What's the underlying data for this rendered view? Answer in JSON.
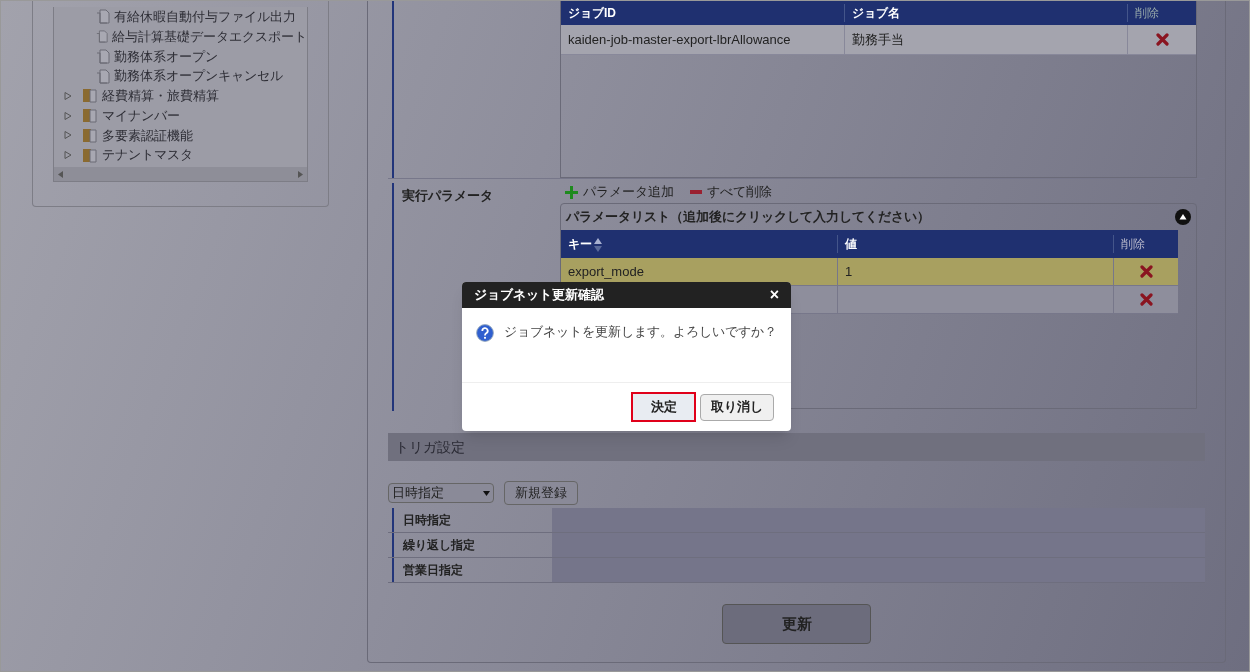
{
  "tree": {
    "items": [
      {
        "kind": "file",
        "label": "有給休暇自動付与ファイル出力"
      },
      {
        "kind": "file",
        "label": "給与計算基礎データエクスポート"
      },
      {
        "kind": "file",
        "label": "勤務体系オープン"
      },
      {
        "kind": "file",
        "label": "勤務体系オープンキャンセル"
      },
      {
        "kind": "folder",
        "label": "経費精算・旅費精算",
        "expanded": false
      },
      {
        "kind": "folder",
        "label": "マイナンバー",
        "expanded": false
      },
      {
        "kind": "folder",
        "label": "多要素認証機能",
        "expanded": false
      },
      {
        "kind": "folder",
        "label": "テナントマスタ",
        "expanded": false
      }
    ]
  },
  "jobs": {
    "columns": [
      "ジョブID",
      "ジョブ名",
      "削除"
    ],
    "rows": [
      {
        "id": "kaiden-job-master-export-lbrAllowance",
        "name": "勤務手当"
      }
    ]
  },
  "params": {
    "label": "実行パラメータ",
    "add": "パラメータ追加",
    "remove_all": "すべて削除",
    "list_title": "パラメータリスト（追加後にクリックして入力してください）",
    "columns": [
      "キー",
      "値",
      "削除"
    ],
    "rows": [
      {
        "key": "export_mode",
        "value": "1",
        "selected": true
      },
      {
        "key": "",
        "value": "",
        "selected": false
      }
    ]
  },
  "trigger": {
    "title": "トリガ設定",
    "select": "日時指定",
    "new_button": "新規登録",
    "rows": [
      "日時指定",
      "繰り返し指定",
      "営業日指定"
    ]
  },
  "update_button": "更新",
  "dialog": {
    "title": "ジョブネット更新確認",
    "close": "×",
    "message": "ジョブネットを更新します。よろしいですか？",
    "ok": "決定",
    "cancel": "取り消し"
  }
}
